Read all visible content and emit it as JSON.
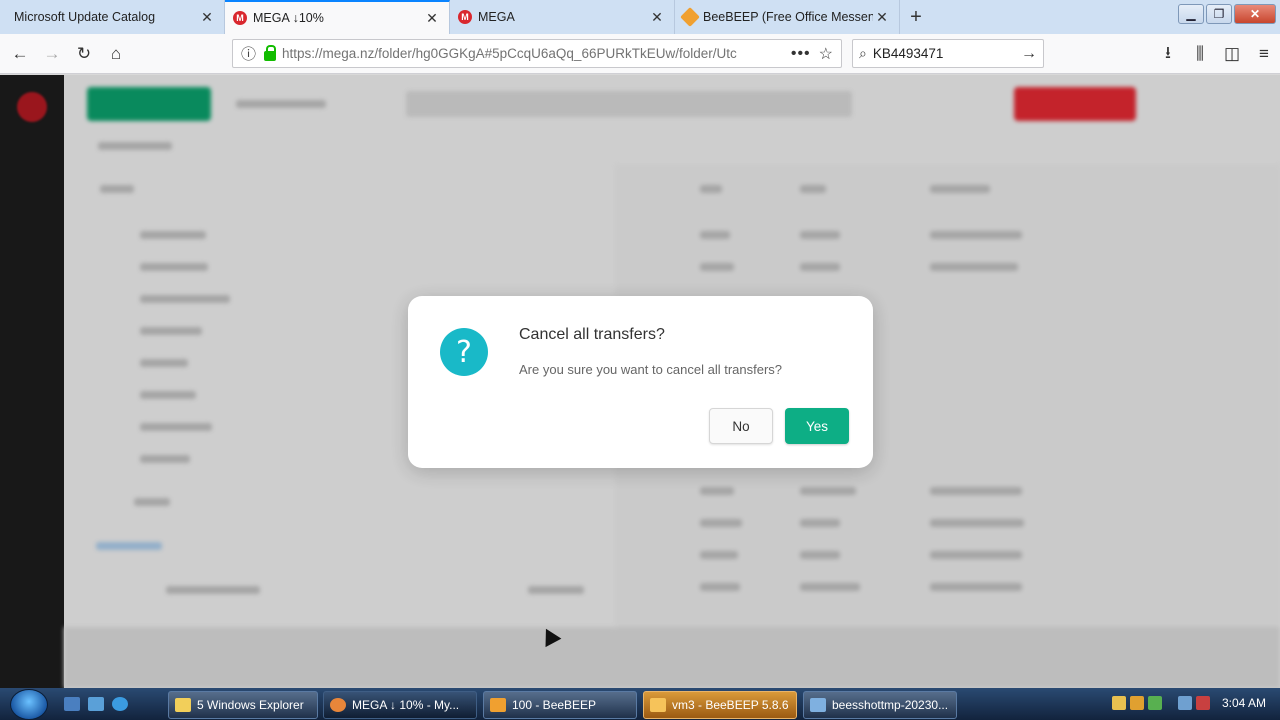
{
  "tabs": [
    {
      "label": "Microsoft Update Catalog",
      "favicon": "none"
    },
    {
      "label": "MEGA ↓10%",
      "favicon": "mega"
    },
    {
      "label": "MEGA",
      "favicon": "mega"
    },
    {
      "label": "BeeBEEP (Free Office Messeng",
      "favicon": "beebeep"
    }
  ],
  "address": {
    "url": "https://mega.nz/folder/hg0GGKgA#5pCcqU6aQq_66PURkTkEUw/folder/Utc"
  },
  "search": {
    "value": "KB4493471"
  },
  "dialog": {
    "title": "Cancel all transfers?",
    "message": "Are you sure you want to cancel all transfers?",
    "no_label": "No",
    "yes_label": "Yes",
    "icon_glyph": "?",
    "icon": "question-icon"
  },
  "taskbar": {
    "items": [
      {
        "label": "5 Windows Explorer",
        "icon": "folder-icon"
      },
      {
        "label": "MEGA ↓ 10% - My...",
        "icon": "firefox-icon"
      },
      {
        "label": "100 - BeeBEEP",
        "icon": "beebeep-icon"
      },
      {
        "label": "vm3 - BeeBEEP 5.8.6",
        "icon": "beebeep-icon"
      },
      {
        "label": "beesshottmp-20230...",
        "icon": "image-icon"
      }
    ],
    "clock": "3:04 AM"
  },
  "colors": {
    "mega_red": "#d9272e",
    "yes_green": "#0dae85",
    "question_cyan": "#19b9c8"
  }
}
